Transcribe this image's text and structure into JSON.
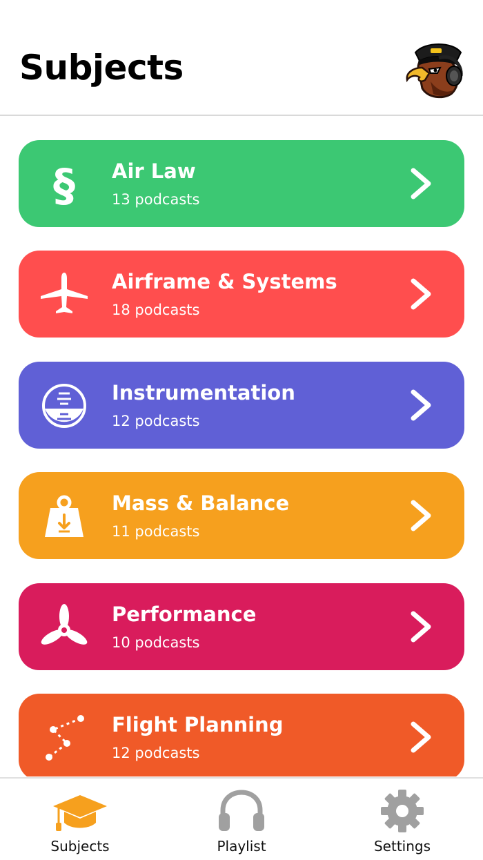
{
  "header": {
    "title": "Subjects"
  },
  "subjects": [
    {
      "name": "Air Law",
      "count": "13 podcasts",
      "color": "#3cc873",
      "icon": "section-sign-icon"
    },
    {
      "name": "Airframe & Systems",
      "count": "18 podcasts",
      "color": "#ff4e4e",
      "icon": "airplane-icon"
    },
    {
      "name": "Instrumentation",
      "count": "12 podcasts",
      "color": "#6060d6",
      "icon": "attitude-indicator-icon"
    },
    {
      "name": "Mass & Balance",
      "count": "11 podcasts",
      "color": "#f6a01e",
      "icon": "weight-icon"
    },
    {
      "name": "Performance",
      "count": "10 podcasts",
      "color": "#d91c5c",
      "icon": "propeller-icon"
    },
    {
      "name": "Flight Planning",
      "count": "12 podcasts",
      "color": "#f05a28",
      "icon": "route-icon"
    }
  ],
  "tabs": [
    {
      "label": "Subjects",
      "icon": "graduation-cap-icon",
      "color": "#f6a01e"
    },
    {
      "label": "Playlist",
      "icon": "headphones-icon",
      "color": "#9e9e9e"
    },
    {
      "label": "Settings",
      "icon": "gear-icon",
      "color": "#9e9e9e"
    }
  ]
}
